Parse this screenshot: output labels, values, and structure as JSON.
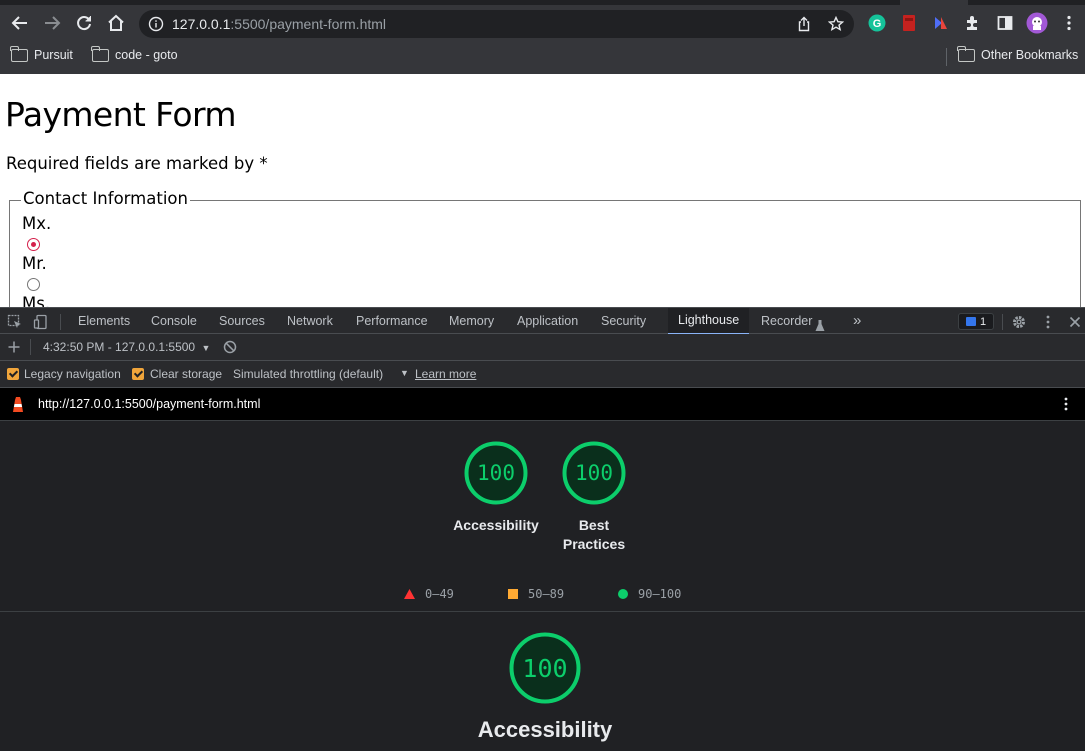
{
  "browser": {
    "url_host": "127.0.0.1",
    "url_rest": ":5500/payment-form.html",
    "bookmarks": [
      {
        "label": "Pursuit"
      },
      {
        "label": "code - goto"
      }
    ],
    "other_bookmarks": "Other Bookmarks"
  },
  "page": {
    "title": "Payment Form",
    "required_note": "Required fields are marked by *",
    "legend": "Contact Information",
    "radios": [
      {
        "label": "Mx.",
        "checked": true
      },
      {
        "label": "Mr.",
        "checked": false
      },
      {
        "label": "Ms.",
        "checked": false
      }
    ]
  },
  "devtools": {
    "tabs": [
      "Elements",
      "Console",
      "Sources",
      "Network",
      "Performance",
      "Memory",
      "Application",
      "Security",
      "Lighthouse",
      "Recorder"
    ],
    "active_tab": "Lighthouse",
    "more": "»",
    "issues_count": "1",
    "report_selector": "4:32:50 PM - 127.0.0.1:5500",
    "options": {
      "legacy_navigation": "Legacy navigation",
      "clear_storage": "Clear storage",
      "throttling": "Simulated throttling (default)",
      "learn_more": "Learn more"
    },
    "report_url": "http://127.0.0.1:5500/payment-form.html",
    "scores": [
      {
        "label": "Accessibility",
        "value": "100"
      },
      {
        "label": "Best Practices",
        "label_line1": "Best",
        "label_line2": "Practices",
        "value": "100"
      }
    ],
    "legend": [
      {
        "range": "0–49",
        "color": "#ff3333",
        "shape": "triangle"
      },
      {
        "range": "50–89",
        "color": "#ffaa33",
        "shape": "square"
      },
      {
        "range": "90–100",
        "color": "#0cce6b",
        "shape": "circle"
      }
    ],
    "section": {
      "label": "Accessibility",
      "value": "100"
    }
  }
}
